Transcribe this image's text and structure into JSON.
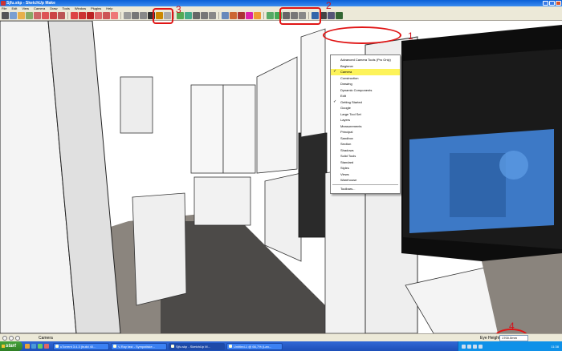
{
  "window": {
    "title": "Sjfu.skp - SketchUp Make"
  },
  "menu": [
    "File",
    "Edit",
    "View",
    "Camera",
    "Draw",
    "Tools",
    "Window",
    "Plugins",
    "Help"
  ],
  "toolbar_dropdown": {
    "items": [
      {
        "label": "Advanced Camera Tools (Pro Only)",
        "checked": false
      },
      {
        "label": "Beginner",
        "checked": false
      },
      {
        "label": "Camera",
        "checked": true,
        "selected": true
      },
      {
        "label": "Construction",
        "checked": false
      },
      {
        "label": "Drawing",
        "checked": false
      },
      {
        "label": "Dynamic Components",
        "checked": false
      },
      {
        "label": "Edit",
        "checked": false
      },
      {
        "label": "Getting Started",
        "checked": true
      },
      {
        "label": "Google",
        "checked": false
      },
      {
        "label": "Large Tool Set",
        "checked": false
      },
      {
        "label": "Layers",
        "checked": false
      },
      {
        "label": "Measurements",
        "checked": false
      },
      {
        "label": "Principal",
        "checked": false
      },
      {
        "label": "Sandbox",
        "checked": false
      },
      {
        "label": "Section",
        "checked": false
      },
      {
        "label": "Shadows",
        "checked": false
      },
      {
        "label": "Solid Tools",
        "checked": false
      },
      {
        "label": "Standard",
        "checked": false
      },
      {
        "label": "Styles",
        "checked": false
      },
      {
        "label": "Views",
        "checked": false
      },
      {
        "label": "Warehouse",
        "checked": false
      },
      {
        "label": "Toolbars...",
        "checked": false
      }
    ],
    "check_glyph": "✓"
  },
  "annotations": {
    "one": "1",
    "two": "2",
    "three": "3",
    "four": "4",
    "color": "#e01515"
  },
  "status": {
    "tool_name": "Camera",
    "eye_height_label": "Eye Height",
    "eye_height_value": "1700.0mm"
  },
  "taskbar": {
    "start_label": "start",
    "tasks": [
      {
        "label": "uTorrent 3.4.3 (build 40...",
        "active": false
      },
      {
        "label": "V-Ray fast - Sympatiske...",
        "active": false
      },
      {
        "label": "Sjfu.skp - SketchUp M...",
        "active": true
      },
      {
        "label": "Untitled-1 @ 66,7% (Lan...",
        "active": false
      }
    ],
    "clock": "11:38"
  }
}
